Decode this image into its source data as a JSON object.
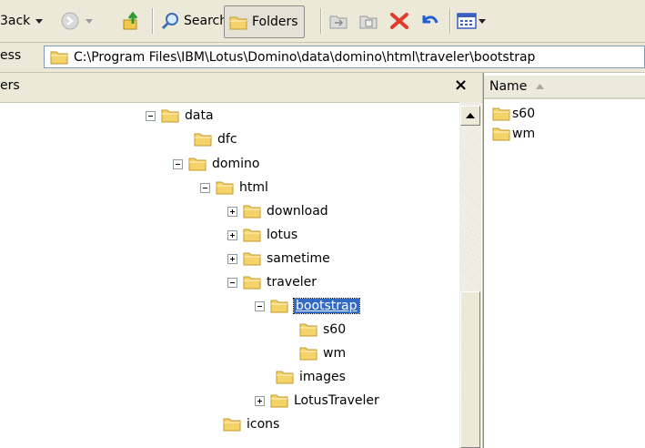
{
  "toolbar": {
    "back_label": "3ack",
    "search_label": "Search",
    "folders_label": "Folders"
  },
  "address": {
    "label": "ess",
    "path": "C:\\Program Files\\IBM\\Lotus\\Domino\\data\\domino\\html\\traveler\\bootstrap"
  },
  "folders_pane": {
    "title": "ers",
    "close_symbol": "×"
  },
  "tree": [
    {
      "label": "data",
      "expander": "minus"
    },
    {
      "label": "dfc",
      "expander": "none"
    },
    {
      "label": "domino",
      "expander": "minus"
    },
    {
      "label": "html",
      "expander": "minus"
    },
    {
      "label": "download",
      "expander": "plus"
    },
    {
      "label": "lotus",
      "expander": "plus"
    },
    {
      "label": "sametime",
      "expander": "plus"
    },
    {
      "label": "traveler",
      "expander": "minus"
    },
    {
      "label": "bootstrap",
      "expander": "minus",
      "selected": true
    },
    {
      "label": "s60",
      "expander": "none"
    },
    {
      "label": "wm",
      "expander": "none"
    },
    {
      "label": "images",
      "expander": "none"
    },
    {
      "label": "LotusTraveler",
      "expander": "plus"
    },
    {
      "label": "icons",
      "expander": "none"
    }
  ],
  "files": {
    "column_name": "Name",
    "items": [
      "s60",
      "wm"
    ]
  },
  "colors": {
    "selection": "#316ac5",
    "folder": "#f5d36b",
    "delete_red": "#e03a2f",
    "undo_blue": "#1f5fcf"
  }
}
